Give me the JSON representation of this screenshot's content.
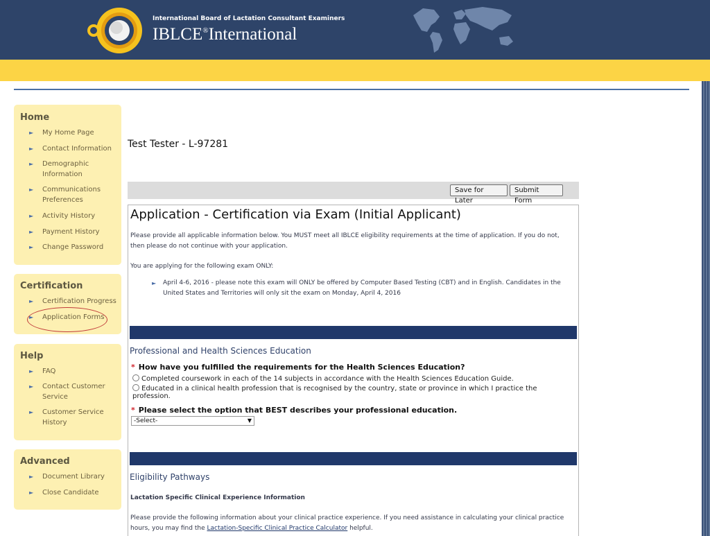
{
  "header": {
    "org_name": "International Board of Lactation Consultant Examiners",
    "brand": "IBLCE",
    "brand_mark": "®",
    "brand_suffix": "International"
  },
  "sidebar": {
    "sections": [
      {
        "title": "Home",
        "items": [
          {
            "label": "My Home Page"
          },
          {
            "label": "Contact Information"
          },
          {
            "label": "Demographic Information"
          },
          {
            "label": "Communications Preferences"
          },
          {
            "label": "Activity History"
          },
          {
            "label": "Payment History"
          },
          {
            "label": "Change Password"
          }
        ]
      },
      {
        "title": "Certification",
        "items": [
          {
            "label": "Certification Progress"
          },
          {
            "label": "Application Forms"
          }
        ]
      },
      {
        "title": "Help",
        "items": [
          {
            "label": "FAQ"
          },
          {
            "label": "Contact Customer Service"
          },
          {
            "label": "Customer Service History"
          }
        ]
      },
      {
        "title": "Advanced",
        "items": [
          {
            "label": "Document Library"
          },
          {
            "label": "Close Candidate"
          }
        ]
      }
    ]
  },
  "main": {
    "candidate": "Test Tester - L-97281",
    "buttons": {
      "save": "Save for Later",
      "submit": "Submit Form"
    },
    "form": {
      "title": "Application - Certification via Exam (Initial Applicant)",
      "intro": "Please provide all applicable information below. You MUST meet all IBLCE eligibility requirements at the time of application. If you do not, then please do not continue with your application.",
      "exam_lead": "You are applying for the following exam ONLY:",
      "exam_item": "April 4-6, 2016 - please note this exam will ONLY be offered by Computer Based Testing (CBT) and in English. Candidates in the United States and Territories will only sit the exam on Monday, April 4, 2016",
      "education_section": "Professional and Health Sciences Education",
      "required_mark": "*",
      "q1": "How have you fulfilled the requirements for the Health Sciences Education?",
      "q1_option1": "Completed coursework in each of the 14 subjects in accordance with the Health Sciences Education Guide.",
      "q1_option2": "Educated in a clinical health profession that is recognised by the country, state or province in which I practice the profession.",
      "q2": "Please select the option that BEST describes your professional education.",
      "select_value": "-Select-",
      "pathways_section": "Eligibility Pathways",
      "clinical_heading": "Lactation Specific Clinical Experience Information",
      "clinical_text_1": "Please provide the following information about your clinical practice experience. If you need assistance in calculating your clinical practice hours, you may find the",
      "calculator_link": "Lactation-Specific Clinical Practice Calculator",
      "clinical_text_2": "helpful."
    }
  },
  "colors": {
    "header_navy": "#2e4469",
    "band_yellow": "#fcd445",
    "sidebar_cream": "#fdf0b2",
    "section_band": "#20386a",
    "required_red": "#d0262e"
  }
}
